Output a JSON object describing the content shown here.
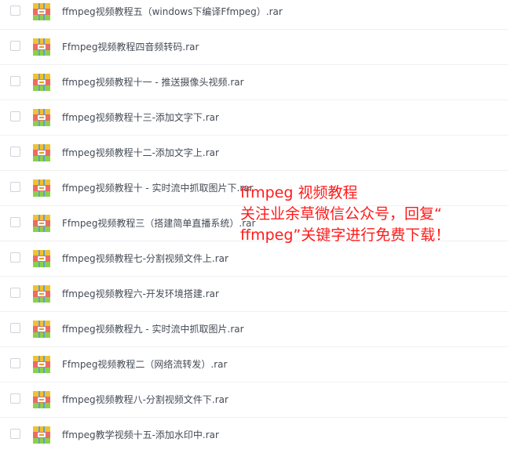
{
  "files": [
    {
      "name": "ffmpeg视频教程五（windows下编译Ffmpeg）.rar"
    },
    {
      "name": "Ffmpeg视频教程四音频转码.rar"
    },
    {
      "name": "ffmpeg视频教程十一 - 推送摄像头视频.rar"
    },
    {
      "name": "ffmpeg视频教程十三-添加文字下.rar"
    },
    {
      "name": "ffmpeg视频教程十二-添加文字上.rar"
    },
    {
      "name": "ffmpeg视频教程十 - 实时流中抓取图片下.rar"
    },
    {
      "name": "Ffmpeg视频教程三（搭建简单直播系统）.rar"
    },
    {
      "name": "ffmpeg视频教程七-分割视频文件上.rar"
    },
    {
      "name": "ffmpeg视频教程六-开发环境搭建.rar"
    },
    {
      "name": "ffmpeg视频教程九 - 实时流中抓取图片.rar"
    },
    {
      "name": "Ffmpeg视频教程二（网络流转发）.rar"
    },
    {
      "name": "ffmpeg视频教程八-分割视频文件下.rar"
    },
    {
      "name": "ffmpeg教学视频十五-添加水印中.rar"
    }
  ],
  "overlay": {
    "line1": "ffmpeg 视频教程",
    "line2": "关注业余草微信公众号，回复“",
    "line3": "ffmpeg”关键字进行免费下载！"
  },
  "icon": "archive-rar-icon",
  "colors": {
    "overlay_text": "#ff1a1a",
    "file_text": "#444b55"
  }
}
